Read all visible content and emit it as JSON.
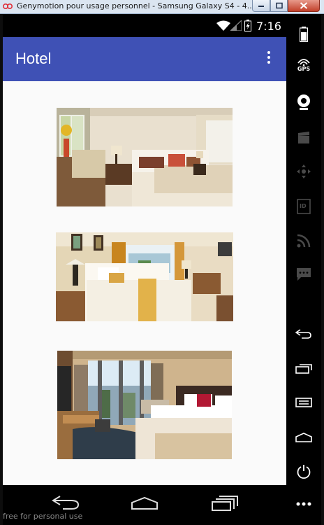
{
  "window": {
    "title": "Genymotion pour usage personnel - Samsung Galaxy S4 - 4...."
  },
  "status_bar": {
    "time": "7:16"
  },
  "app_bar": {
    "title": "Hotel"
  },
  "images": [
    {
      "description": "hotel room photo 1"
    },
    {
      "description": "hotel room photo 2"
    },
    {
      "description": "hotel room photo 3"
    }
  ],
  "fab": {
    "icon": "mail-icon",
    "color": "#e8437a"
  },
  "watermark": "free for personal use",
  "side_panel": {
    "gps_label": "GPS",
    "id_label": "ID"
  },
  "colors": {
    "app_bar": "#3f51b5",
    "background": "#fafafa",
    "fab": "#e8437a"
  }
}
